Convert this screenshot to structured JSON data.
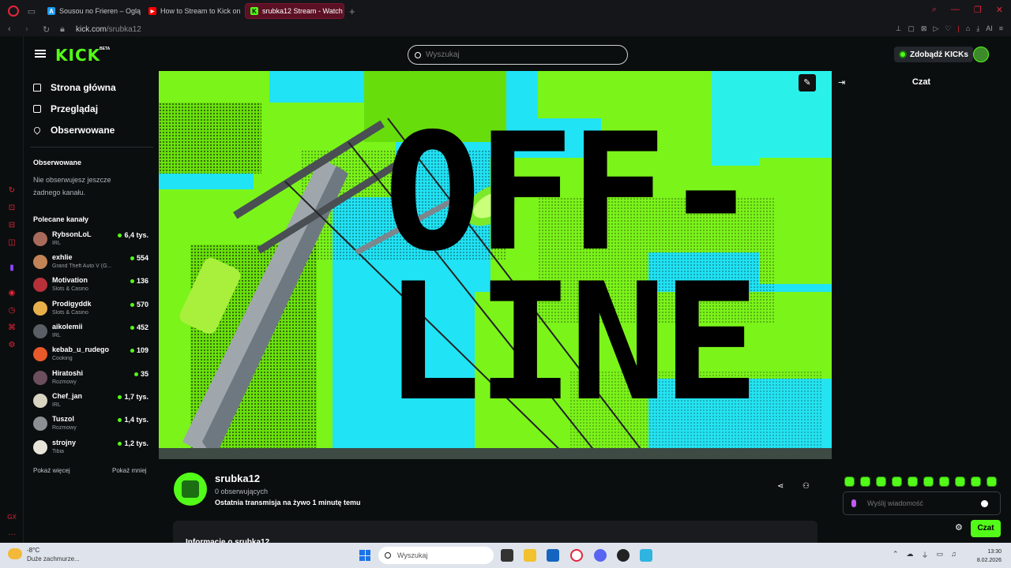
{
  "browser": {
    "tabs": [
      {
        "label": "Sousou no Frieren – Oglą",
        "color": "#1a9bf0",
        "fav": "A"
      },
      {
        "label": "How to Stream to Kick on",
        "color": "#ff0000",
        "fav": "▶"
      },
      {
        "label": "srubka12 Stream - Watch L",
        "color": "#53fc18",
        "fav": "K"
      }
    ],
    "url_host": "kick.com",
    "url_path": "/srubka12",
    "ai_label": "AI"
  },
  "header": {
    "logo": "KICK",
    "logo_badge": "BETA",
    "search_placeholder": "Wyszukaj",
    "kicks_button": "Zdobądź KICKs"
  },
  "sidebar": {
    "nav": [
      {
        "label": "Strona główna",
        "icon": "home-icon"
      },
      {
        "label": "Przeglądaj",
        "icon": "browse-icon"
      },
      {
        "label": "Obserwowane",
        "icon": "heart-icon"
      }
    ],
    "followed_title": "Obserwowane",
    "followed_empty": "Nie obserwujesz jeszcze żadnego kanału.",
    "recommended_title": "Polecane kanały",
    "channels": [
      {
        "name": "RybsonLoL",
        "category": "IRL",
        "viewers": "6,4 tys.",
        "color": "#a86b5b"
      },
      {
        "name": "exhlie",
        "category": "Grand Theft Auto V (G...",
        "viewers": "554",
        "color": "#c28457"
      },
      {
        "name": "Motivation",
        "category": "Slots & Casino",
        "viewers": "136",
        "color": "#b7303a"
      },
      {
        "name": "Prodigyddk",
        "category": "Slots & Casino",
        "viewers": "570",
        "color": "#e8b04a"
      },
      {
        "name": "aikolemii",
        "category": "IRL",
        "viewers": "452",
        "color": "#5a5f66"
      },
      {
        "name": "kebab_u_rudego",
        "category": "Cooking",
        "viewers": "109",
        "color": "#e85a2a"
      },
      {
        "name": "Hiratoshi",
        "category": "Rozmowy",
        "viewers": "35",
        "color": "#6b4f5e"
      },
      {
        "name": "Chef_jan",
        "category": "IRL",
        "viewers": "1,7 tys.",
        "color": "#d9d3c2"
      },
      {
        "name": "Tuszol",
        "category": "Rozmowy",
        "viewers": "1,4 tys.",
        "color": "#8c8f94"
      },
      {
        "name": "strojny",
        "category": "Tibia",
        "viewers": "1,2 tys.",
        "color": "#e9e4da"
      }
    ],
    "show_more": "Pokaż więcej",
    "show_less": "Pokaż mniej"
  },
  "player": {
    "offline_line1": "OFF-",
    "offline_line2": "LINE"
  },
  "channel": {
    "name": "srubka12",
    "followers": "0 obserwujących",
    "last_stream": "Ostatnia transmisja na żywo 1 minutę temu",
    "about_title": "Informacje o srubka12"
  },
  "chat": {
    "title": "Czat",
    "input_placeholder": "Wyślij wiadomość",
    "send_label": "Czat"
  },
  "taskbar": {
    "temp": "-8°C",
    "weather": "Duże zachmurze...",
    "search_placeholder": "Wyszukaj",
    "time": "13:30",
    "date": "8.02.2026"
  }
}
